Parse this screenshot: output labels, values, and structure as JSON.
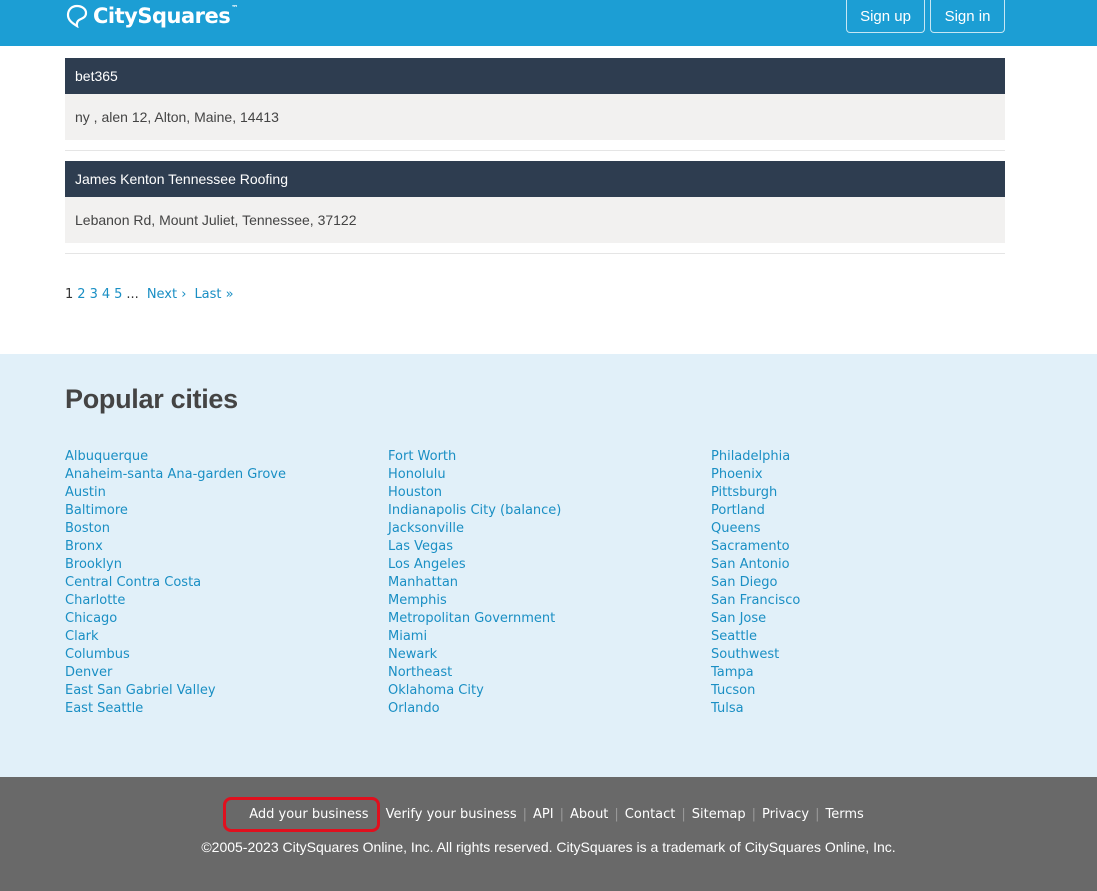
{
  "header": {
    "logo_text": "CitySquares",
    "logo_tm": "™",
    "signup_label": "Sign up",
    "signin_label": "Sign in"
  },
  "listings": [
    {
      "name": "bet365",
      "address": "ny , alen 12, Alton, Maine, 14413"
    },
    {
      "name": "James Kenton Tennessee Roofing",
      "address": "Lebanon Rd, Mount Juliet, Tennessee, 37122"
    }
  ],
  "pager": {
    "current": "1",
    "pages": [
      "2",
      "3",
      "4",
      "5"
    ],
    "ellipsis": "...",
    "next": "Next ›",
    "last": "Last »"
  },
  "popular": {
    "title": "Popular cities",
    "columns": [
      [
        "Albuquerque",
        "Anaheim-santa Ana-garden Grove",
        "Austin",
        "Baltimore",
        "Boston",
        "Bronx",
        "Brooklyn",
        "Central Contra Costa",
        "Charlotte",
        "Chicago",
        "Clark",
        "Columbus",
        "Denver",
        "East San Gabriel Valley",
        "East Seattle"
      ],
      [
        "Fort Worth",
        "Honolulu",
        "Houston",
        "Indianapolis City (balance)",
        "Jacksonville",
        "Las Vegas",
        "Los Angeles",
        "Manhattan",
        "Memphis",
        "Metropolitan Government",
        "Miami",
        "Newark",
        "Northeast",
        "Oklahoma City",
        "Orlando"
      ],
      [
        "Philadelphia",
        "Phoenix",
        "Pittsburgh",
        "Portland",
        "Queens",
        "Sacramento",
        "San Antonio",
        "San Diego",
        "San Francisco",
        "San Jose",
        "Seattle",
        "Southwest",
        "Tampa",
        "Tucson",
        "Tulsa"
      ]
    ]
  },
  "footer": {
    "links": [
      "Add your business",
      "Verify your business",
      "API",
      "About",
      "Contact",
      "Sitemap",
      "Privacy",
      "Terms"
    ],
    "separator": "|",
    "copyright": "©2005-2023 CitySquares Online, Inc. All rights reserved. CitySquares is a trademark of CitySquares Online, Inc."
  },
  "colors": {
    "header_bg": "#1c9ed4",
    "listing_header_bg": "#2e3d50",
    "link": "#1a8fc4",
    "cities_bg": "#e1f0f9",
    "footer_bg": "#696969",
    "highlight": "#e0101e"
  },
  "icons": {
    "logo": "map-pin-icon"
  }
}
